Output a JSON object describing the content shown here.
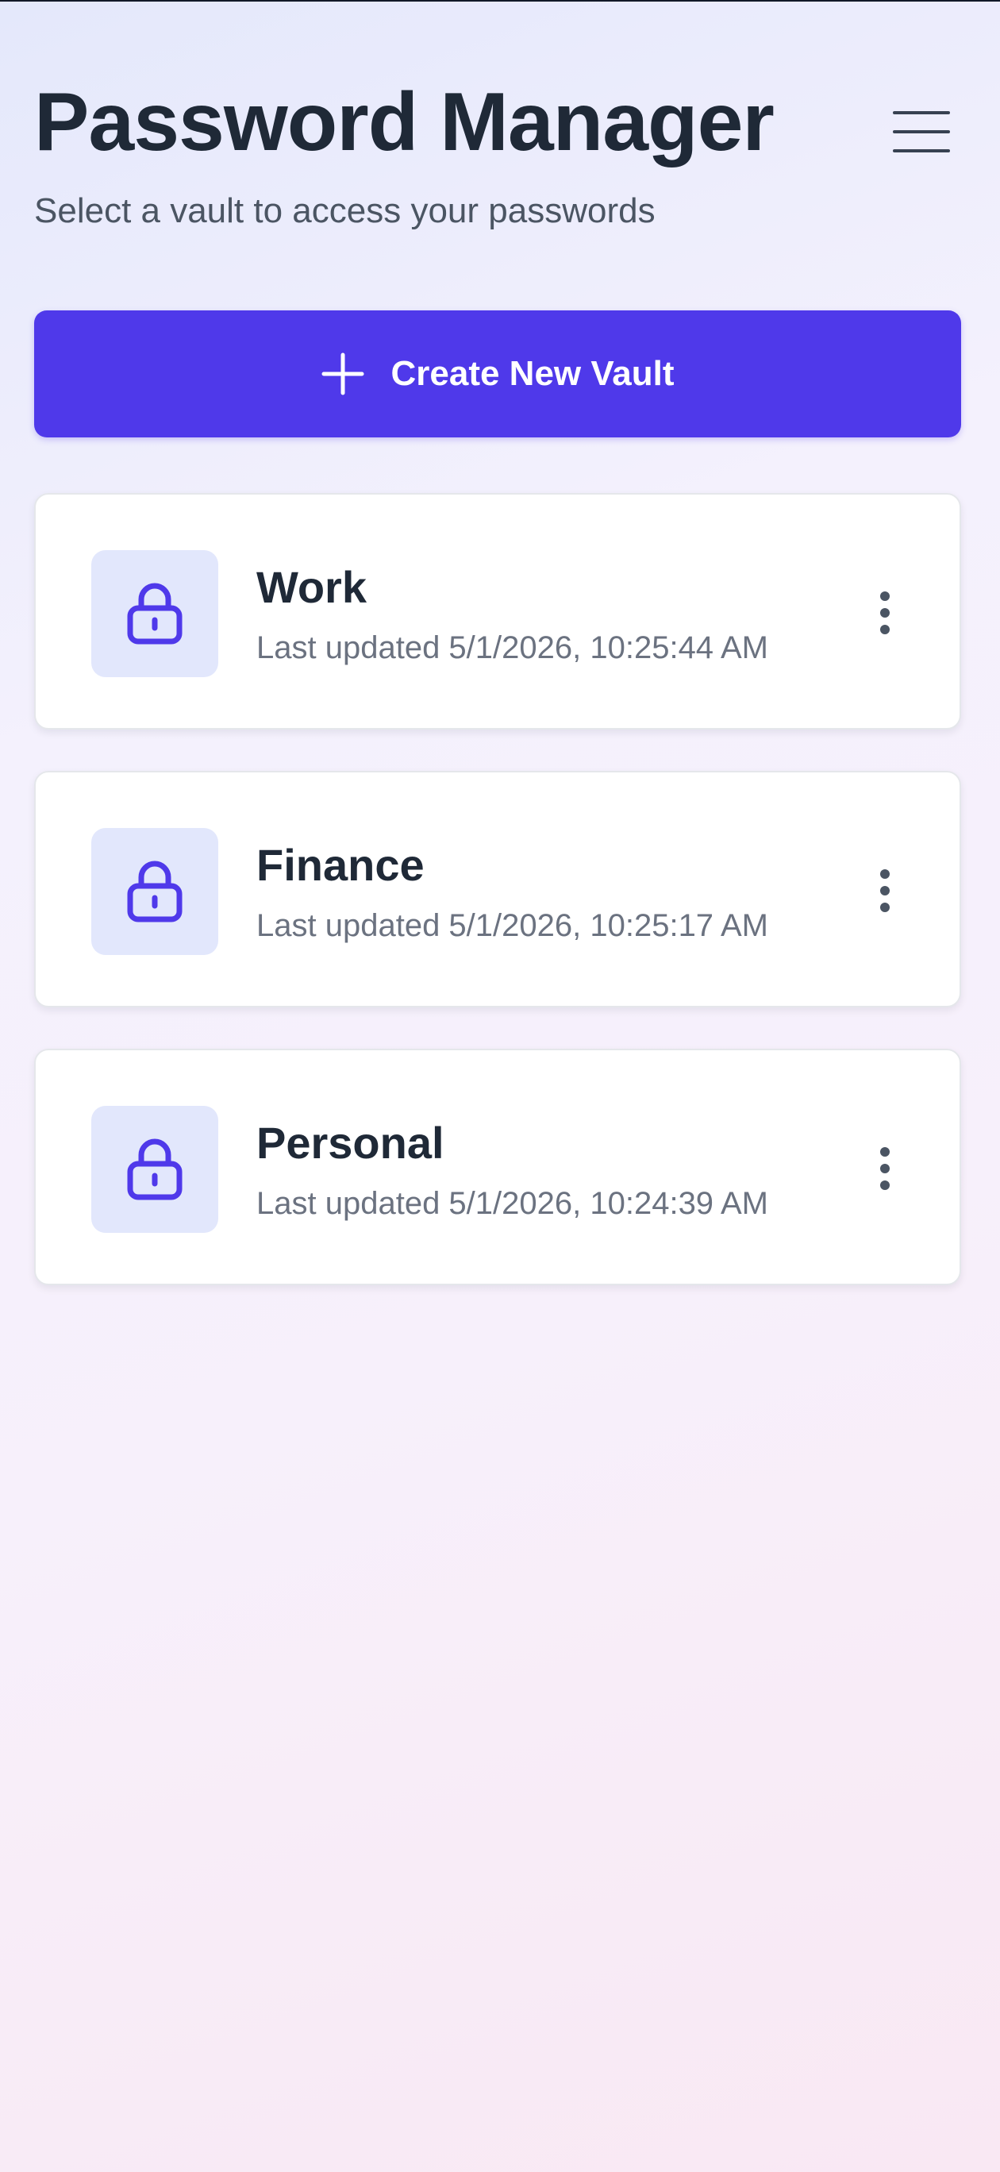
{
  "header": {
    "title": "Password Manager",
    "subtitle": "Select a vault to access your passwords",
    "menu_icon": "hamburger-menu-icon"
  },
  "actions": {
    "create_vault_label": "Create New Vault",
    "create_vault_icon": "plus-icon"
  },
  "vaults": [
    {
      "name": "Work",
      "updated": "Last updated 5/1/2026, 10:25:44 AM",
      "icon": "lock-icon",
      "menu_icon": "more-vertical-icon"
    },
    {
      "name": "Finance",
      "updated": "Last updated 5/1/2026, 10:25:17 AM",
      "icon": "lock-icon",
      "menu_icon": "more-vertical-icon"
    },
    {
      "name": "Personal",
      "updated": "Last updated 5/1/2026, 10:24:39 AM",
      "icon": "lock-icon",
      "menu_icon": "more-vertical-icon"
    }
  ],
  "colors": {
    "accent": "#4f39ea",
    "icon_background": "#e2e7fc",
    "title_text": "#1f2937",
    "secondary_text": "#6b7280"
  }
}
